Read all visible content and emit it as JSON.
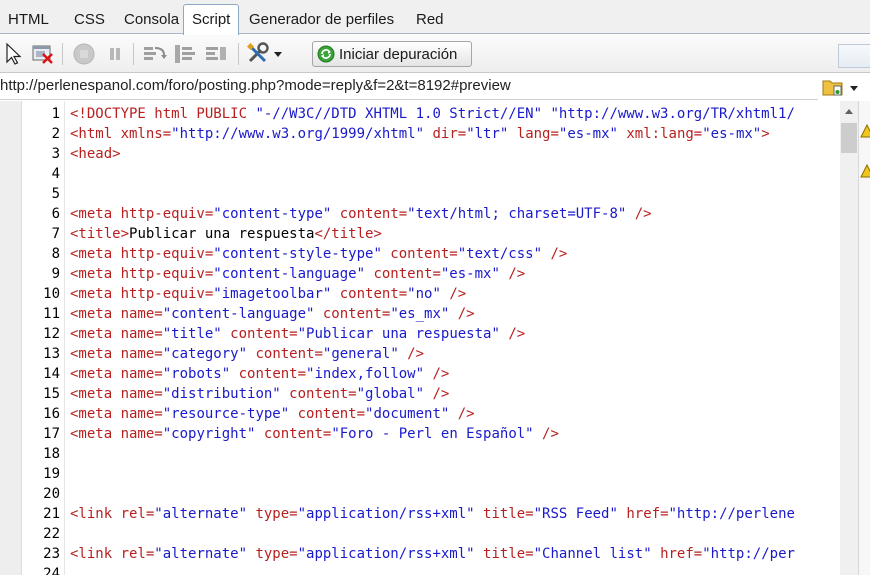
{
  "tabs": [
    {
      "label": "HTML",
      "active": false
    },
    {
      "label": "CSS",
      "active": false
    },
    {
      "label": "Consola",
      "active": false
    },
    {
      "label": "Script",
      "active": true
    },
    {
      "label": "Generador de perfiles",
      "active": false
    },
    {
      "label": "Red",
      "active": false
    }
  ],
  "toolbar": {
    "icons": [
      "inspect-icon",
      "clear-breakpoints-icon",
      "stop-icon",
      "pause-icon",
      "step-over-icon",
      "step-into-icon",
      "step-out-icon",
      "tools-icon",
      "dropdown-arrow-icon"
    ],
    "run_label": "Iniciar depuración"
  },
  "url": "http://perlenespanol.com/foro/posting.php?mode=reply&f=2&t=8192#preview",
  "colors": {
    "tag": "#b81f1f",
    "value": "#1a1acc",
    "text": "#000000"
  },
  "code": {
    "lines": [
      {
        "n": "1",
        "tokens": [
          {
            "c": "tag",
            "t": "<!DOCTYPE html PUBLIC "
          },
          {
            "c": "val",
            "t": "\"-//W3C//DTD XHTML 1.0 Strict//EN\""
          },
          {
            "c": "txt",
            "t": " "
          },
          {
            "c": "val",
            "t": "\"http://www.w3.org/TR/xhtml1/"
          }
        ]
      },
      {
        "n": "2",
        "tokens": [
          {
            "c": "tag",
            "t": "<html "
          },
          {
            "c": "attr",
            "t": "xmlns="
          },
          {
            "c": "val",
            "t": "\"http://www.w3.org/1999/xhtml\""
          },
          {
            "c": "attr",
            "t": " dir="
          },
          {
            "c": "val",
            "t": "\"ltr\""
          },
          {
            "c": "attr",
            "t": " lang="
          },
          {
            "c": "val",
            "t": "\"es-mx\""
          },
          {
            "c": "attr",
            "t": " xml:lang="
          },
          {
            "c": "val",
            "t": "\"es-mx\""
          },
          {
            "c": "tag",
            "t": ">"
          }
        ]
      },
      {
        "n": "3",
        "tokens": [
          {
            "c": "tag",
            "t": "<head>"
          }
        ]
      },
      {
        "n": "4",
        "tokens": []
      },
      {
        "n": "5",
        "tokens": []
      },
      {
        "n": "6",
        "tokens": [
          {
            "c": "tag",
            "t": "<meta "
          },
          {
            "c": "attr",
            "t": "http-equiv="
          },
          {
            "c": "val",
            "t": "\"content-type\""
          },
          {
            "c": "attr",
            "t": " content="
          },
          {
            "c": "val",
            "t": "\"text/html; charset=UTF-8\""
          },
          {
            "c": "tag",
            "t": " />"
          }
        ]
      },
      {
        "n": "7",
        "tokens": [
          {
            "c": "tag",
            "t": "<title>"
          },
          {
            "c": "txt",
            "t": "Publicar una respuesta"
          },
          {
            "c": "tag",
            "t": "</title>"
          }
        ]
      },
      {
        "n": "8",
        "tokens": [
          {
            "c": "tag",
            "t": "<meta "
          },
          {
            "c": "attr",
            "t": "http-equiv="
          },
          {
            "c": "val",
            "t": "\"content-style-type\""
          },
          {
            "c": "attr",
            "t": " content="
          },
          {
            "c": "val",
            "t": "\"text/css\""
          },
          {
            "c": "tag",
            "t": " />"
          }
        ]
      },
      {
        "n": "9",
        "tokens": [
          {
            "c": "tag",
            "t": "<meta "
          },
          {
            "c": "attr",
            "t": "http-equiv="
          },
          {
            "c": "val",
            "t": "\"content-language\""
          },
          {
            "c": "attr",
            "t": " content="
          },
          {
            "c": "val",
            "t": "\"es-mx\""
          },
          {
            "c": "tag",
            "t": " />"
          }
        ]
      },
      {
        "n": "10",
        "tokens": [
          {
            "c": "tag",
            "t": "<meta "
          },
          {
            "c": "attr",
            "t": "http-equiv="
          },
          {
            "c": "val",
            "t": "\"imagetoolbar\""
          },
          {
            "c": "attr",
            "t": " content="
          },
          {
            "c": "val",
            "t": "\"no\""
          },
          {
            "c": "tag",
            "t": " />"
          }
        ]
      },
      {
        "n": "11",
        "tokens": [
          {
            "c": "tag",
            "t": "<meta "
          },
          {
            "c": "attr",
            "t": "name="
          },
          {
            "c": "val",
            "t": "\"content-language\""
          },
          {
            "c": "attr",
            "t": " content="
          },
          {
            "c": "val",
            "t": "\"es_mx\""
          },
          {
            "c": "tag",
            "t": " />"
          }
        ]
      },
      {
        "n": "12",
        "tokens": [
          {
            "c": "tag",
            "t": "<meta "
          },
          {
            "c": "attr",
            "t": "name="
          },
          {
            "c": "val",
            "t": "\"title\""
          },
          {
            "c": "attr",
            "t": " content="
          },
          {
            "c": "val",
            "t": "\"Publicar una respuesta\""
          },
          {
            "c": "tag",
            "t": " />"
          }
        ]
      },
      {
        "n": "13",
        "tokens": [
          {
            "c": "tag",
            "t": "<meta "
          },
          {
            "c": "attr",
            "t": "name="
          },
          {
            "c": "val",
            "t": "\"category\""
          },
          {
            "c": "attr",
            "t": " content="
          },
          {
            "c": "val",
            "t": "\"general\""
          },
          {
            "c": "tag",
            "t": " />"
          }
        ]
      },
      {
        "n": "14",
        "tokens": [
          {
            "c": "tag",
            "t": "<meta "
          },
          {
            "c": "attr",
            "t": "name="
          },
          {
            "c": "val",
            "t": "\"robots\""
          },
          {
            "c": "attr",
            "t": " content="
          },
          {
            "c": "val",
            "t": "\"index,follow\""
          },
          {
            "c": "tag",
            "t": " />"
          }
        ]
      },
      {
        "n": "15",
        "tokens": [
          {
            "c": "tag",
            "t": "<meta "
          },
          {
            "c": "attr",
            "t": "name="
          },
          {
            "c": "val",
            "t": "\"distribution\""
          },
          {
            "c": "attr",
            "t": " content="
          },
          {
            "c": "val",
            "t": "\"global\""
          },
          {
            "c": "tag",
            "t": " />"
          }
        ]
      },
      {
        "n": "16",
        "tokens": [
          {
            "c": "tag",
            "t": "<meta "
          },
          {
            "c": "attr",
            "t": "name="
          },
          {
            "c": "val",
            "t": "\"resource-type\""
          },
          {
            "c": "attr",
            "t": " content="
          },
          {
            "c": "val",
            "t": "\"document\""
          },
          {
            "c": "tag",
            "t": " />"
          }
        ]
      },
      {
        "n": "17",
        "tokens": [
          {
            "c": "tag",
            "t": "<meta "
          },
          {
            "c": "attr",
            "t": "name="
          },
          {
            "c": "val",
            "t": "\"copyright\""
          },
          {
            "c": "attr",
            "t": " content="
          },
          {
            "c": "val",
            "t": "\"Foro - Perl en Español\""
          },
          {
            "c": "tag",
            "t": " />"
          }
        ]
      },
      {
        "n": "18",
        "tokens": []
      },
      {
        "n": "19",
        "tokens": []
      },
      {
        "n": "20",
        "tokens": []
      },
      {
        "n": "21",
        "tokens": [
          {
            "c": "tag",
            "t": "<link "
          },
          {
            "c": "attr",
            "t": "rel="
          },
          {
            "c": "val",
            "t": "\"alternate\""
          },
          {
            "c": "attr",
            "t": " type="
          },
          {
            "c": "val",
            "t": "\"application/rss+xml\""
          },
          {
            "c": "attr",
            "t": " title="
          },
          {
            "c": "val",
            "t": "\"RSS Feed\""
          },
          {
            "c": "attr",
            "t": " href="
          },
          {
            "c": "val",
            "t": "\"http://perlene"
          }
        ]
      },
      {
        "n": "22",
        "tokens": []
      },
      {
        "n": "23",
        "tokens": [
          {
            "c": "tag",
            "t": "<link "
          },
          {
            "c": "attr",
            "t": "rel="
          },
          {
            "c": "val",
            "t": "\"alternate\""
          },
          {
            "c": "attr",
            "t": " type="
          },
          {
            "c": "val",
            "t": "\"application/rss+xml\""
          },
          {
            "c": "attr",
            "t": " title="
          },
          {
            "c": "val",
            "t": "\"Channel list\""
          },
          {
            "c": "attr",
            "t": " href="
          },
          {
            "c": "val",
            "t": "\"http://per"
          }
        ]
      },
      {
        "n": "24",
        "tokens": []
      }
    ]
  }
}
